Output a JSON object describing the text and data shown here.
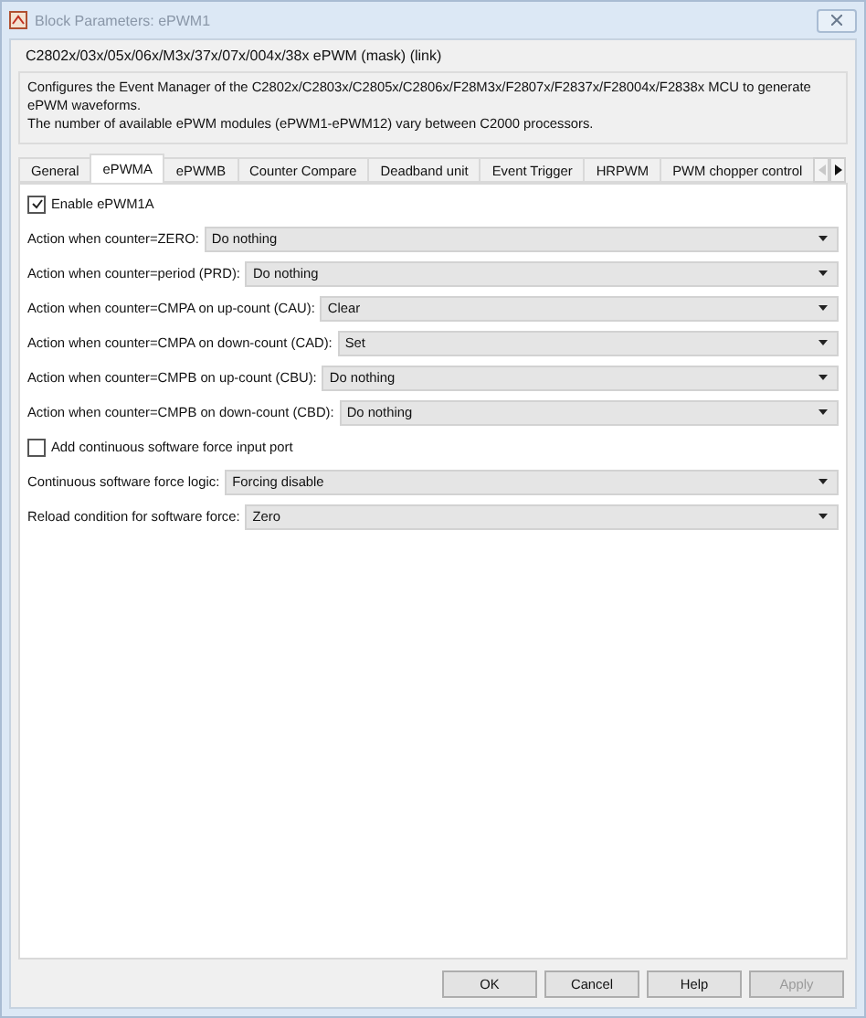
{
  "window": {
    "title": "Block Parameters: ePWM1"
  },
  "mask_title": "C2802x/03x/05x/06x/M3x/37x/07x/004x/38x ePWM (mask) (link)",
  "description": [
    "Configures the Event Manager of the C2802x/C2803x/C2805x/C2806x/F28M3x/F2807x/F2837x/F28004x/F2838x MCU to generate ePWM waveforms.",
    "The number of available ePWM modules (ePWM1-ePWM12) vary between C2000 processors."
  ],
  "tabs": [
    {
      "label": "General",
      "selected": false
    },
    {
      "label": "ePWMA",
      "selected": true
    },
    {
      "label": "ePWMB",
      "selected": false
    },
    {
      "label": "Counter Compare",
      "selected": false
    },
    {
      "label": "Deadband unit",
      "selected": false
    },
    {
      "label": "Event Trigger",
      "selected": false
    },
    {
      "label": "HRPWM",
      "selected": false
    },
    {
      "label": "PWM chopper control",
      "selected": false
    }
  ],
  "params": [
    {
      "kind": "checkbox",
      "label": "Enable ePWM1A",
      "checked": true
    },
    {
      "kind": "dropdown",
      "label": "Action when counter=ZERO:",
      "value": "Do nothing"
    },
    {
      "kind": "dropdown",
      "label": "Action when counter=period (PRD):",
      "value": "Do nothing"
    },
    {
      "kind": "dropdown",
      "label": "Action when counter=CMPA on up-count (CAU):",
      "value": "Clear"
    },
    {
      "kind": "dropdown",
      "label": "Action when counter=CMPA on down-count (CAD):",
      "value": "Set"
    },
    {
      "kind": "dropdown",
      "label": "Action when counter=CMPB on up-count (CBU):",
      "value": "Do nothing"
    },
    {
      "kind": "dropdown",
      "label": "Action when counter=CMPB on down-count (CBD):",
      "value": "Do nothing"
    },
    {
      "kind": "checkbox",
      "label": "Add continuous software force input port",
      "checked": false
    },
    {
      "kind": "dropdown",
      "label": "Continuous software force logic:",
      "value": "Forcing disable"
    },
    {
      "kind": "dropdown",
      "label": "Reload condition for software force:",
      "value": "Zero"
    }
  ],
  "buttons": [
    {
      "label": "OK",
      "disabled": false
    },
    {
      "label": "Cancel",
      "disabled": false
    },
    {
      "label": "Help",
      "disabled": false
    },
    {
      "label": "Apply",
      "disabled": true
    }
  ]
}
